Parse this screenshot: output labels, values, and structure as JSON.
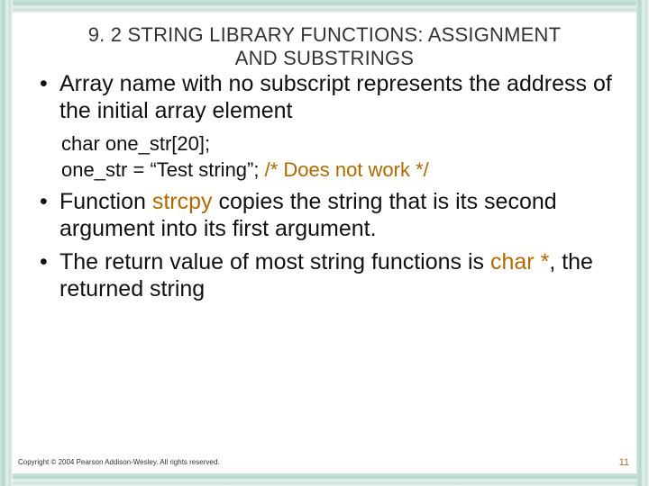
{
  "title_line1": "9. 2 STRING LIBRARY FUNCTIONS: ASSIGNMENT",
  "title_line2": "AND SUBSTRINGS",
  "bullets": {
    "b1": "Array name with no subscript represents the address of the initial array element",
    "code1": "char one_str[20];",
    "code2a": "one_str = “Test string”;  ",
    "code2b": "/* Does not work */",
    "b2a": "Function ",
    "b2_kw": "strcpy",
    "b2b": " copies the string that is its second argument into its first argument.",
    "b3a": "The return value of most string functions is ",
    "b3_kw": "char *",
    "b3b": ", the returned string"
  },
  "footer": "Copyright © 2004 Pearson Addison-Wesley. All rights reserved.",
  "page": "11"
}
